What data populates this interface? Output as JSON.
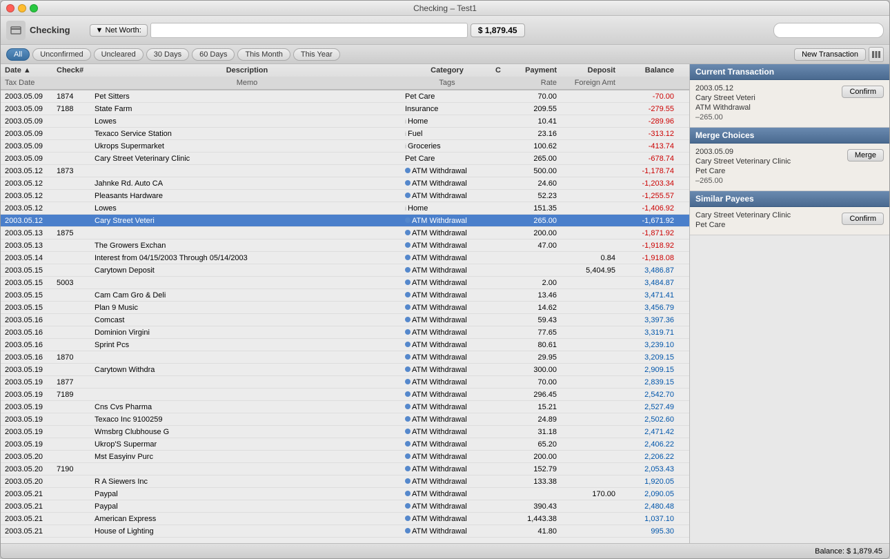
{
  "window": {
    "title": "Checking – Test1"
  },
  "toolbar": {
    "account_label": "Checking",
    "net_worth_label": "▼ Net Worth:",
    "net_worth_value": "$ 1,879.45",
    "search_placeholder": ""
  },
  "filters": {
    "buttons": [
      "All",
      "Unconfirmed",
      "Uncleared",
      "30 Days",
      "60 Days",
      "This Month",
      "This Year"
    ],
    "active": "All",
    "new_transaction": "New Transaction"
  },
  "table": {
    "headers": {
      "row1": [
        "Date",
        "Check#",
        "Description",
        "Category",
        "C",
        "Payment",
        "Deposit",
        "Balance"
      ],
      "row2": [
        "Tax Date",
        "",
        "Memo",
        "Tags",
        "",
        "Rate",
        "Foreign Amt",
        ""
      ]
    },
    "rows": [
      {
        "date": "2003.05.09",
        "check": "1874",
        "desc": "Pet Sitters",
        "memo": "",
        "cat": "Pet Care",
        "tags": "",
        "c": "",
        "payment": "70.00",
        "deposit": "",
        "balance": "-70.00",
        "balance_type": "negative",
        "selected": false
      },
      {
        "date": "2003.05.09",
        "check": "7188",
        "desc": "State Farm",
        "memo": "",
        "cat": "Insurance",
        "tags": "",
        "c": "",
        "payment": "209.55",
        "deposit": "",
        "balance": "-279.55",
        "balance_type": "negative",
        "selected": false
      },
      {
        "date": "2003.05.09",
        "check": "",
        "desc": "Lowes",
        "memo": "",
        "cat": "Home",
        "tags": "",
        "c": "i",
        "payment": "10.41",
        "deposit": "",
        "balance": "-289.96",
        "balance_type": "negative",
        "selected": false
      },
      {
        "date": "2003.05.09",
        "check": "",
        "desc": "Texaco Service Station",
        "memo": "",
        "cat": "Fuel",
        "tags": "",
        "c": "i",
        "payment": "23.16",
        "deposit": "",
        "balance": "-313.12",
        "balance_type": "negative",
        "selected": false
      },
      {
        "date": "2003.05.09",
        "check": "",
        "desc": "Ukrops Supermarket",
        "memo": "",
        "cat": "Groceries",
        "tags": "",
        "c": "i",
        "payment": "100.62",
        "deposit": "",
        "balance": "-413.74",
        "balance_type": "negative",
        "selected": false
      },
      {
        "date": "2003.05.09",
        "check": "",
        "desc": "Cary Street Veterinary Clinic",
        "memo": "",
        "cat": "Pet Care",
        "tags": "",
        "c": "",
        "payment": "265.00",
        "deposit": "",
        "balance": "-678.74",
        "balance_type": "negative",
        "selected": false
      },
      {
        "date": "2003.05.12",
        "check": "1873",
        "desc": "",
        "memo": "",
        "cat": "ATM Withdrawal",
        "tags": "",
        "c": "i●",
        "payment": "500.00",
        "deposit": "",
        "balance": "-1,178.74",
        "balance_type": "negative",
        "selected": false
      },
      {
        "date": "2003.05.12",
        "check": "",
        "desc": "Jahnke Rd. Auto CA",
        "memo": "",
        "cat": "ATM Withdrawal",
        "tags": "",
        "c": "i●",
        "payment": "24.60",
        "deposit": "",
        "balance": "-1,203.34",
        "balance_type": "negative",
        "selected": false
      },
      {
        "date": "2003.05.12",
        "check": "",
        "desc": "Pleasants Hardware",
        "memo": "",
        "cat": "ATM Withdrawal",
        "tags": "",
        "c": "i●",
        "payment": "52.23",
        "deposit": "",
        "balance": "-1,255.57",
        "balance_type": "negative",
        "selected": false
      },
      {
        "date": "2003.05.12",
        "check": "",
        "desc": "Lowes",
        "memo": "",
        "cat": "Home",
        "tags": "",
        "c": "i",
        "payment": "151.35",
        "deposit": "",
        "balance": "-1,406.92",
        "balance_type": "negative",
        "selected": false
      },
      {
        "date": "2003.05.12",
        "check": "",
        "desc": "Cary Street Veteri",
        "memo": "",
        "cat": "ATM Withdrawal",
        "tags": "",
        "c": "i●",
        "payment": "265.00",
        "deposit": "",
        "balance": "-1,671.92",
        "balance_type": "negative",
        "selected": true
      },
      {
        "date": "2003.05.13",
        "check": "1875",
        "desc": "",
        "memo": "",
        "cat": "ATM Withdrawal",
        "tags": "",
        "c": "i●",
        "payment": "200.00",
        "deposit": "",
        "balance": "-1,871.92",
        "balance_type": "negative",
        "selected": false
      },
      {
        "date": "2003.05.13",
        "check": "",
        "desc": "The Growers Exchan",
        "memo": "",
        "cat": "ATM Withdrawal",
        "tags": "",
        "c": "i●",
        "payment": "47.00",
        "deposit": "",
        "balance": "-1,918.92",
        "balance_type": "negative",
        "selected": false
      },
      {
        "date": "2003.05.14",
        "check": "",
        "desc": "Interest from 04/15/2003 Through 05/14/2003",
        "memo": "",
        "cat": "ATM Withdrawal",
        "tags": "",
        "c": "i●",
        "payment": "",
        "deposit": "0.84",
        "balance": "-1,918.08",
        "balance_type": "negative",
        "selected": false
      },
      {
        "date": "2003.05.15",
        "check": "",
        "desc": "Carytown          Deposit",
        "memo": "",
        "cat": "ATM Withdrawal",
        "tags": "",
        "c": "i●",
        "payment": "",
        "deposit": "5,404.95",
        "balance": "3,486.87",
        "balance_type": "positive",
        "selected": false
      },
      {
        "date": "2003.05.15",
        "check": "5003",
        "desc": "",
        "memo": "",
        "cat": "ATM Withdrawal",
        "tags": "",
        "c": "i●",
        "payment": "2.00",
        "deposit": "",
        "balance": "3,484.87",
        "balance_type": "positive",
        "selected": false
      },
      {
        "date": "2003.05.15",
        "check": "",
        "desc": "Cam Cam Gro & Deli",
        "memo": "",
        "cat": "ATM Withdrawal",
        "tags": "",
        "c": "i●",
        "payment": "13.46",
        "deposit": "",
        "balance": "3,471.41",
        "balance_type": "positive",
        "selected": false
      },
      {
        "date": "2003.05.15",
        "check": "",
        "desc": "Plan 9 Music",
        "memo": "",
        "cat": "ATM Withdrawal",
        "tags": "",
        "c": "i●",
        "payment": "14.62",
        "deposit": "",
        "balance": "3,456.79",
        "balance_type": "positive",
        "selected": false
      },
      {
        "date": "2003.05.16",
        "check": "",
        "desc": "Comcast",
        "memo": "",
        "cat": "ATM Withdrawal",
        "tags": "",
        "c": "i●",
        "payment": "59.43",
        "deposit": "",
        "balance": "3,397.36",
        "balance_type": "positive",
        "selected": false
      },
      {
        "date": "2003.05.16",
        "check": "",
        "desc": "Dominion Virgini",
        "memo": "",
        "cat": "ATM Withdrawal",
        "tags": "",
        "c": "i●",
        "payment": "77.65",
        "deposit": "",
        "balance": "3,319.71",
        "balance_type": "positive",
        "selected": false
      },
      {
        "date": "2003.05.16",
        "check": "",
        "desc": "Sprint Pcs",
        "memo": "",
        "cat": "ATM Withdrawal",
        "tags": "",
        "c": "i●",
        "payment": "80.61",
        "deposit": "",
        "balance": "3,239.10",
        "balance_type": "positive",
        "selected": false
      },
      {
        "date": "2003.05.16",
        "check": "1870",
        "desc": "",
        "memo": "",
        "cat": "ATM Withdrawal",
        "tags": "",
        "c": "i●",
        "payment": "29.95",
        "deposit": "",
        "balance": "3,209.15",
        "balance_type": "positive",
        "selected": false
      },
      {
        "date": "2003.05.19",
        "check": "",
        "desc": "Carytown          Withdra",
        "memo": "",
        "cat": "ATM Withdrawal",
        "tags": "",
        "c": "i●",
        "payment": "300.00",
        "deposit": "",
        "balance": "2,909.15",
        "balance_type": "positive",
        "selected": false
      },
      {
        "date": "2003.05.19",
        "check": "1877",
        "desc": "",
        "memo": "",
        "cat": "ATM Withdrawal",
        "tags": "",
        "c": "i●",
        "payment": "70.00",
        "deposit": "",
        "balance": "2,839.15",
        "balance_type": "positive",
        "selected": false
      },
      {
        "date": "2003.05.19",
        "check": "7189",
        "desc": "",
        "memo": "",
        "cat": "ATM Withdrawal",
        "tags": "",
        "c": "i●",
        "payment": "296.45",
        "deposit": "",
        "balance": "2,542.70",
        "balance_type": "positive",
        "selected": false
      },
      {
        "date": "2003.05.19",
        "check": "",
        "desc": "Cns Cvs Pharma",
        "memo": "",
        "cat": "ATM Withdrawal",
        "tags": "",
        "c": "i●",
        "payment": "15.21",
        "deposit": "",
        "balance": "2,527.49",
        "balance_type": "positive",
        "selected": false
      },
      {
        "date": "2003.05.19",
        "check": "",
        "desc": "Texaco Inc 9100259",
        "memo": "",
        "cat": "ATM Withdrawal",
        "tags": "",
        "c": "i●",
        "payment": "24.89",
        "deposit": "",
        "balance": "2,502.60",
        "balance_type": "positive",
        "selected": false
      },
      {
        "date": "2003.05.19",
        "check": "",
        "desc": "Wmsbrg Clubhouse G",
        "memo": "",
        "cat": "ATM Withdrawal",
        "tags": "",
        "c": "i●",
        "payment": "31.18",
        "deposit": "",
        "balance": "2,471.42",
        "balance_type": "positive",
        "selected": false
      },
      {
        "date": "2003.05.19",
        "check": "",
        "desc": "Ukrop'S Supermar",
        "memo": "",
        "cat": "ATM Withdrawal",
        "tags": "",
        "c": "i●",
        "payment": "65.20",
        "deposit": "",
        "balance": "2,406.22",
        "balance_type": "positive",
        "selected": false
      },
      {
        "date": "2003.05.20",
        "check": "",
        "desc": "Mst Easyinv Purc",
        "memo": "",
        "cat": "ATM Withdrawal",
        "tags": "",
        "c": "i●",
        "payment": "200.00",
        "deposit": "",
        "balance": "2,206.22",
        "balance_type": "positive",
        "selected": false
      },
      {
        "date": "2003.05.20",
        "check": "7190",
        "desc": "",
        "memo": "",
        "cat": "ATM Withdrawal",
        "tags": "",
        "c": "i●",
        "payment": "152.79",
        "deposit": "",
        "balance": "2,053.43",
        "balance_type": "positive",
        "selected": false
      },
      {
        "date": "2003.05.20",
        "check": "",
        "desc": "R A Siewers Inc",
        "memo": "",
        "cat": "ATM Withdrawal",
        "tags": "",
        "c": "i●",
        "payment": "133.38",
        "deposit": "",
        "balance": "1,920.05",
        "balance_type": "positive",
        "selected": false
      },
      {
        "date": "2003.05.21",
        "check": "",
        "desc": "Paypal",
        "memo": "",
        "cat": "ATM Withdrawal",
        "tags": "",
        "c": "i●",
        "payment": "",
        "deposit": "170.00",
        "balance": "2,090.05",
        "balance_type": "positive",
        "selected": false
      },
      {
        "date": "2003.05.21",
        "check": "",
        "desc": "Paypal",
        "memo": "",
        "cat": "ATM Withdrawal",
        "tags": "",
        "c": "i●",
        "payment": "390.43",
        "deposit": "",
        "balance": "2,480.48",
        "balance_type": "positive",
        "selected": false
      },
      {
        "date": "2003.05.21",
        "check": "",
        "desc": "American Express",
        "memo": "",
        "cat": "ATM Withdrawal",
        "tags": "",
        "c": "i●",
        "payment": "1,443.38",
        "deposit": "",
        "balance": "1,037.10",
        "balance_type": "positive",
        "selected": false
      },
      {
        "date": "2003.05.21",
        "check": "",
        "desc": "House of Lighting",
        "memo": "",
        "cat": "ATM Withdrawal",
        "tags": "",
        "c": "i●",
        "payment": "41.80",
        "deposit": "",
        "balance": "995.30",
        "balance_type": "positive",
        "selected": false
      }
    ]
  },
  "right_panel": {
    "current_transaction": {
      "title": "Current Transaction",
      "date": "2003.05.12",
      "payee": "Cary Street Veteri",
      "category": "ATM Withdrawal",
      "amount": "–265.00",
      "confirm_label": "Confirm"
    },
    "merge_choices": {
      "title": "Merge Choices",
      "date": "2003.05.09",
      "payee": "Cary Street Veterinary Clinic",
      "category": "Pet Care",
      "amount": "–265.00",
      "merge_label": "Merge"
    },
    "similar_payees": {
      "title": "Similar Payees",
      "payee": "Cary Street Veterinary Clinic",
      "category": "Pet Care",
      "confirm_label": "Confirm"
    }
  },
  "status_bar": {
    "balance_label": "Balance: $ 1,879.45"
  }
}
